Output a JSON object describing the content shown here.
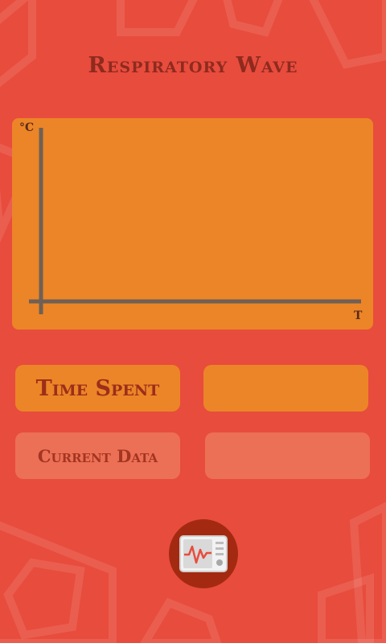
{
  "header": {
    "title": "Respiratory Wave"
  },
  "chart": {
    "y_unit": "°C",
    "x_unit": "T"
  },
  "stats": {
    "time_spent_label": "Time Spent",
    "time_spent_value": "",
    "current_data_label": "Current Data",
    "current_data_value": ""
  },
  "colors": {
    "background": "#E84C3D",
    "panel": "#EC8527",
    "muted_panel": "#EC7055",
    "title": "#8E2A1E",
    "button": "#A32A10"
  },
  "icons": {
    "monitor_button": "ecg-monitor-icon"
  },
  "chart_data": {
    "type": "line",
    "xlabel": "T",
    "ylabel": "°C",
    "series": []
  }
}
